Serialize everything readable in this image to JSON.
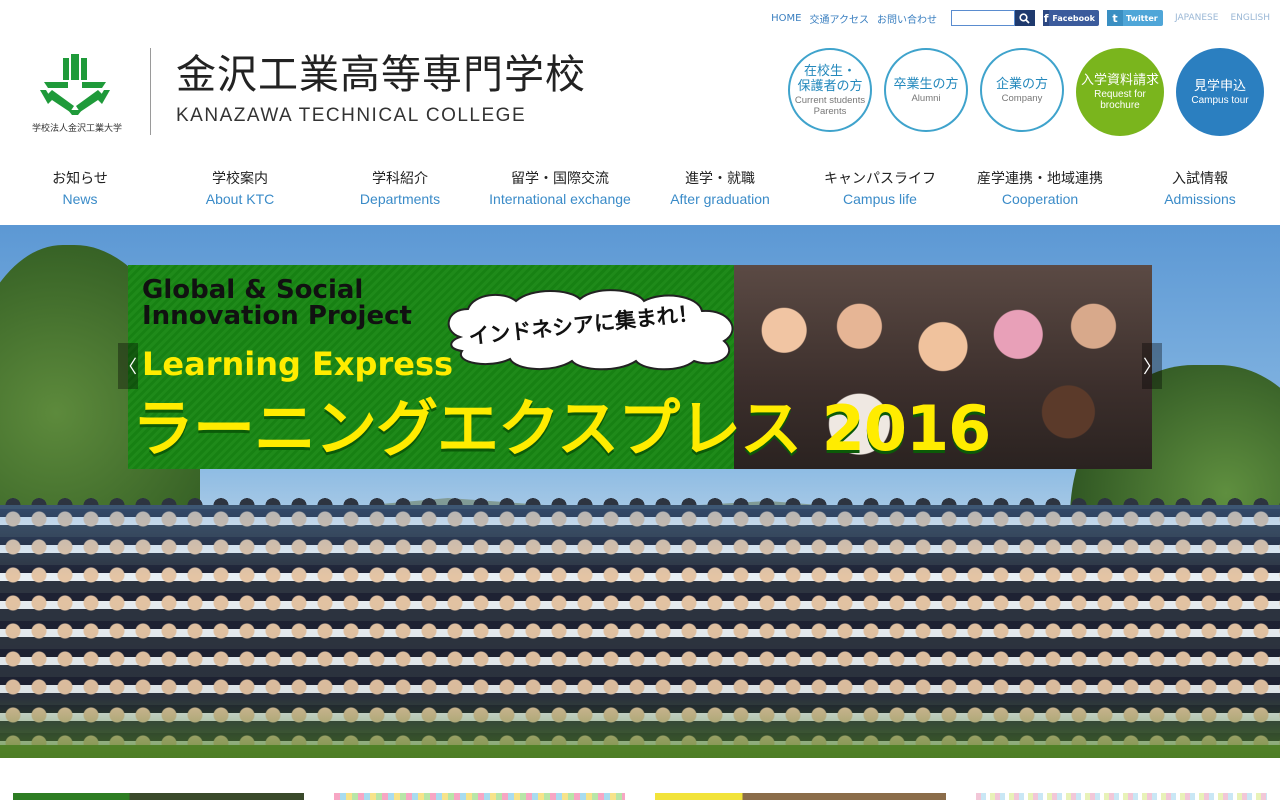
{
  "utility": {
    "links": [
      "HOME",
      "交通アクセス",
      "お問い合わせ"
    ],
    "search_placeholder": "",
    "facebook": "Facebook",
    "twitter": "Twitter",
    "lang_jp": "JAPANESE",
    "lang_en": "ENGLISH"
  },
  "logo": {
    "corp": "学校法人金沢工業大学",
    "name_jp": "金沢工業高等専門学校",
    "name_en": "KANAZAWA TECHNICAL COLLEGE",
    "emblem_color": "#1f9a3a"
  },
  "audience": [
    {
      "jp": "在校生・\n保護者の方",
      "en": "Current students\nParents"
    },
    {
      "jp": "卒業生の方",
      "en": "Alumni"
    },
    {
      "jp": "企業の方",
      "en": "Company"
    },
    {
      "jp": "入学資料請求",
      "en": "Request for\nbrochure"
    },
    {
      "jp": "見学申込",
      "en": "Campus tour"
    }
  ],
  "nav": [
    {
      "jp": "お知らせ",
      "en": "News"
    },
    {
      "jp": "学校案内",
      "en": "About KTC"
    },
    {
      "jp": "学科紹介",
      "en": "Departments"
    },
    {
      "jp": "留学・国際交流",
      "en": "International exchange"
    },
    {
      "jp": "進学・就職",
      "en": "After graduation"
    },
    {
      "jp": "キャンパスライフ",
      "en": "Campus life"
    },
    {
      "jp": "産学連携・地域連携",
      "en": "Cooperation"
    },
    {
      "jp": "入試情報",
      "en": "Admissions"
    }
  ],
  "banner": {
    "line1": "Global & Social",
    "line2": "Innovation Project",
    "bubble": "インドネシアに集まれ！",
    "line3": "Learning Express",
    "headline": "ラーニングエクスプレス 2016",
    "accent_color": "#ffec00",
    "panel_color": "#1f8a1a"
  },
  "slider": {
    "prev": "〈",
    "next": "〉"
  },
  "thumbs": [
    "green-photo",
    "pastel-pattern",
    "yellow-photo",
    "checker-pattern"
  ]
}
